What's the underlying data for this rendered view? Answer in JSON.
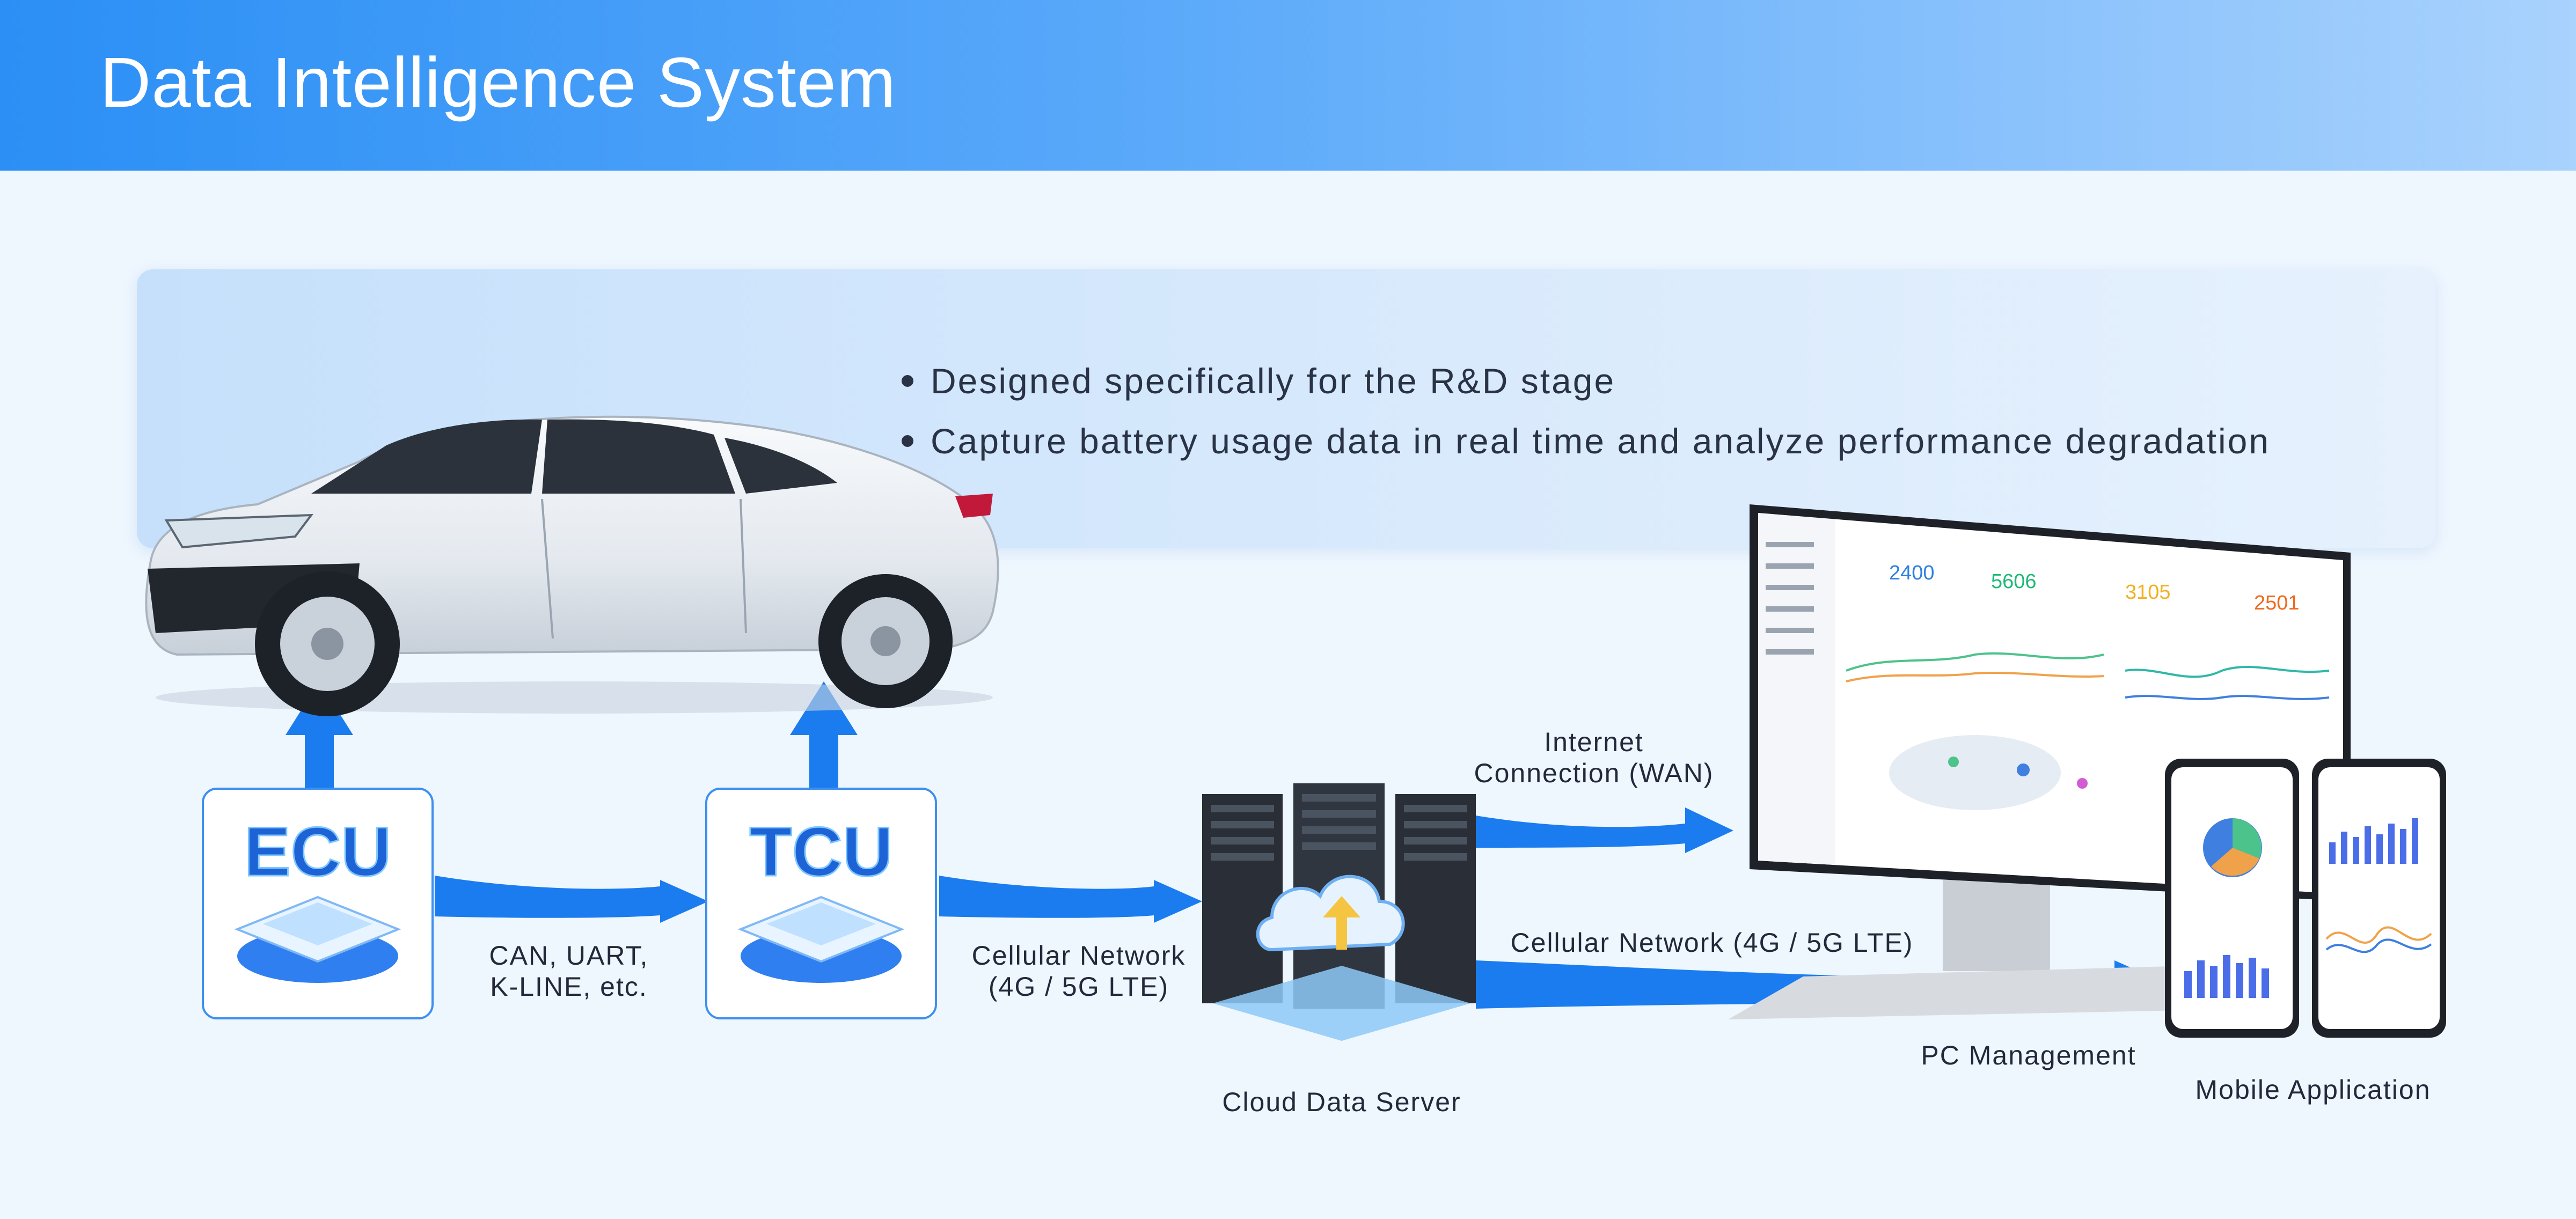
{
  "header": {
    "title": "Data Intelligence System"
  },
  "highlights": [
    "Designed specifically for the R&D stage",
    "Capture battery usage data in real time and analyze performance degradation"
  ],
  "nodes": {
    "ecu": "ECU",
    "tcu": "TCU",
    "cloud": "Cloud Data Server",
    "pc": "PC Management",
    "mobile": "Mobile Application"
  },
  "links": {
    "ecu_tcu_line1": "CAN, UART,",
    "ecu_tcu_line2": "K-LINE, etc.",
    "tcu_cloud_line1": "Cellular Network",
    "tcu_cloud_line2": "(4G / 5G LTE)",
    "cloud_pc_line1": "Internet",
    "cloud_pc_line2": "Connection (WAN)",
    "cloud_mobile": "Cellular Network (4G / 5G LTE)"
  },
  "dashboard": {
    "kpis": [
      "2400",
      "5606",
      "3105",
      "2501"
    ],
    "kpi_colors": [
      "#2f7fe0",
      "#1fb877",
      "#f2b01e",
      "#ee6a1e"
    ]
  },
  "colors": {
    "accent": "#1d7ff0",
    "header_start": "#2b8ff5",
    "header_end": "#a9d2fd"
  }
}
